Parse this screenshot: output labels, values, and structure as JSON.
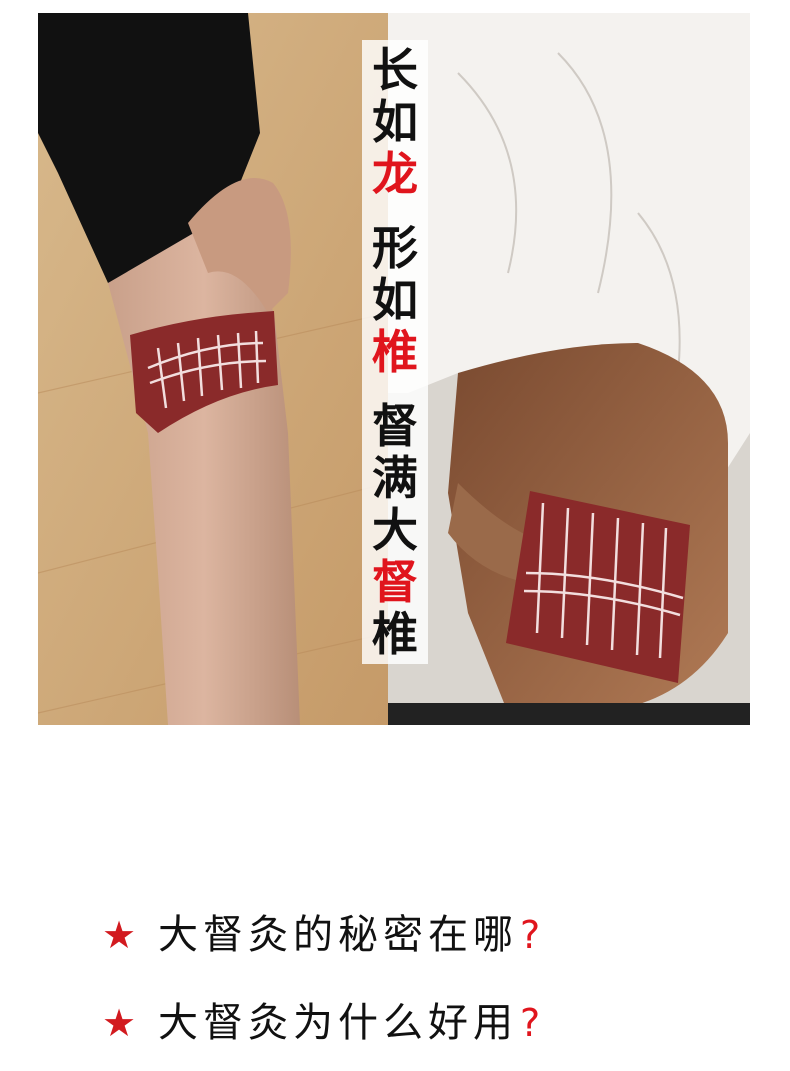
{
  "slogan": {
    "groups": [
      [
        {
          "char": "长",
          "highlight": false
        },
        {
          "char": "如",
          "highlight": false
        },
        {
          "char": "龙",
          "highlight": true
        }
      ],
      [
        {
          "char": "形",
          "highlight": false
        },
        {
          "char": "如",
          "highlight": false
        },
        {
          "char": "椎",
          "highlight": true
        }
      ],
      [
        {
          "char": "督",
          "highlight": false
        },
        {
          "char": "满",
          "highlight": false
        },
        {
          "char": "大",
          "highlight": false
        },
        {
          "char": "督",
          "highlight": true
        },
        {
          "char": "椎",
          "highlight": false
        }
      ]
    ],
    "highlight_color": "#e0151d"
  },
  "questions": [
    {
      "bullet": "★",
      "text": "大督灸的秘密在哪",
      "mark": "?"
    },
    {
      "bullet": "★",
      "text": "大督灸为什么好用",
      "mark": "?"
    }
  ],
  "colors": {
    "star": "#d21a1f",
    "question_mark": "#e0151d",
    "wrap_band": "#8a2a2a"
  }
}
